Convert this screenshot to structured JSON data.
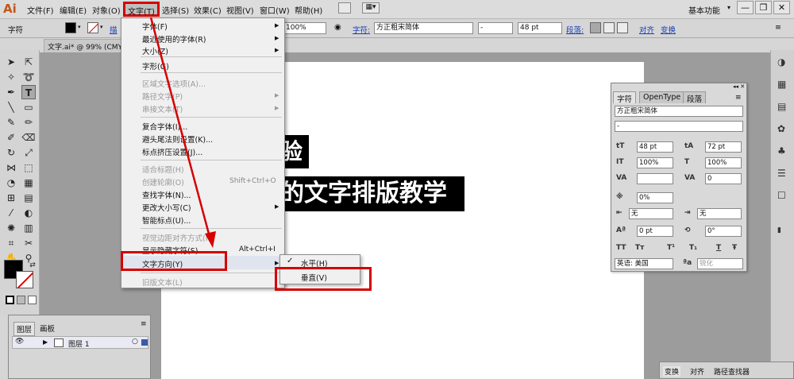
{
  "app": {
    "logo": "Ai"
  },
  "menubar": {
    "items": [
      "文件(F)",
      "编辑(E)",
      "对象(O)",
      "文字(T)",
      "选择(S)",
      "效果(C)",
      "视图(V)",
      "窗口(W)",
      "帮助(H)"
    ],
    "workspace": "基本功能",
    "window_minimize": "—",
    "window_maximize": "❐",
    "window_close": "✕"
  },
  "controlbar": {
    "label": "字符",
    "stroke_partial": "描",
    "opacity": "100%",
    "font_label": "字符:",
    "font": "方正粗宋简体",
    "style": "-",
    "size": "48 pt",
    "paragraph_label": "段落:",
    "align_label": "对齐",
    "transform_label": "变换"
  },
  "document": {
    "tab": "文字.ai* @ 99% (CMYK",
    "text_line1": "验",
    "text_line2": "的文字排版教学"
  },
  "menu": {
    "items": [
      {
        "label": "字体(F)"
      },
      {
        "label": "最近使用的字体(R)"
      },
      {
        "label": "大小(Z)"
      },
      {
        "label": "字形(G)"
      },
      {
        "label": "区域文字选项(A)..."
      },
      {
        "label": "路径文字(P)"
      },
      {
        "label": "串接文本(T)"
      },
      {
        "label": "复合字体(I)..."
      },
      {
        "label": "避头尾法则设置(K)..."
      },
      {
        "label": "标点挤压设置(J)..."
      },
      {
        "label": "适合标题(H)"
      },
      {
        "label": "创建轮廓(O)",
        "shortcut": "Shift+Ctrl+O"
      },
      {
        "label": "查找字体(N)..."
      },
      {
        "label": "更改大小写(C)"
      },
      {
        "label": "智能标点(U)..."
      },
      {
        "label": "视觉边距对齐方式(M)"
      },
      {
        "label": "显示隐藏字符(S)",
        "shortcut": "Alt+Ctrl+I"
      },
      {
        "label": "文字方向(Y)"
      },
      {
        "label": "旧版文本(L)"
      }
    ],
    "submenu": {
      "check": "✓",
      "items": [
        "水平(H)",
        "垂直(V)"
      ]
    }
  },
  "char_panel": {
    "tabs": [
      "字符",
      "OpenType",
      "段落"
    ],
    "font": "方正粗宋简体",
    "style": "-",
    "size": "48 pt",
    "leading": "72 pt",
    "vscale": "100%",
    "hscale": "100%",
    "kerning": "",
    "tracking": "0",
    "tsume": "0%",
    "aki_left": "无",
    "aki_right": "无",
    "baseline": "0 pt",
    "rotation": "0°",
    "language": "英语: 美国",
    "antialias": "锐化",
    "style_buttons": [
      "TT",
      "Tт",
      "T¹",
      "T₁",
      "T",
      "Ŧ"
    ]
  },
  "layers_panel": {
    "tabs": [
      "图层",
      "画板"
    ],
    "layer_name": "图层 1"
  },
  "bottom_panel": {
    "tabs": [
      "变换",
      "对齐",
      "路径查找器"
    ]
  },
  "colors": {
    "annotation": "#d60000",
    "link": "#1a3fb0",
    "selected_menu": "#3b5ba8"
  }
}
